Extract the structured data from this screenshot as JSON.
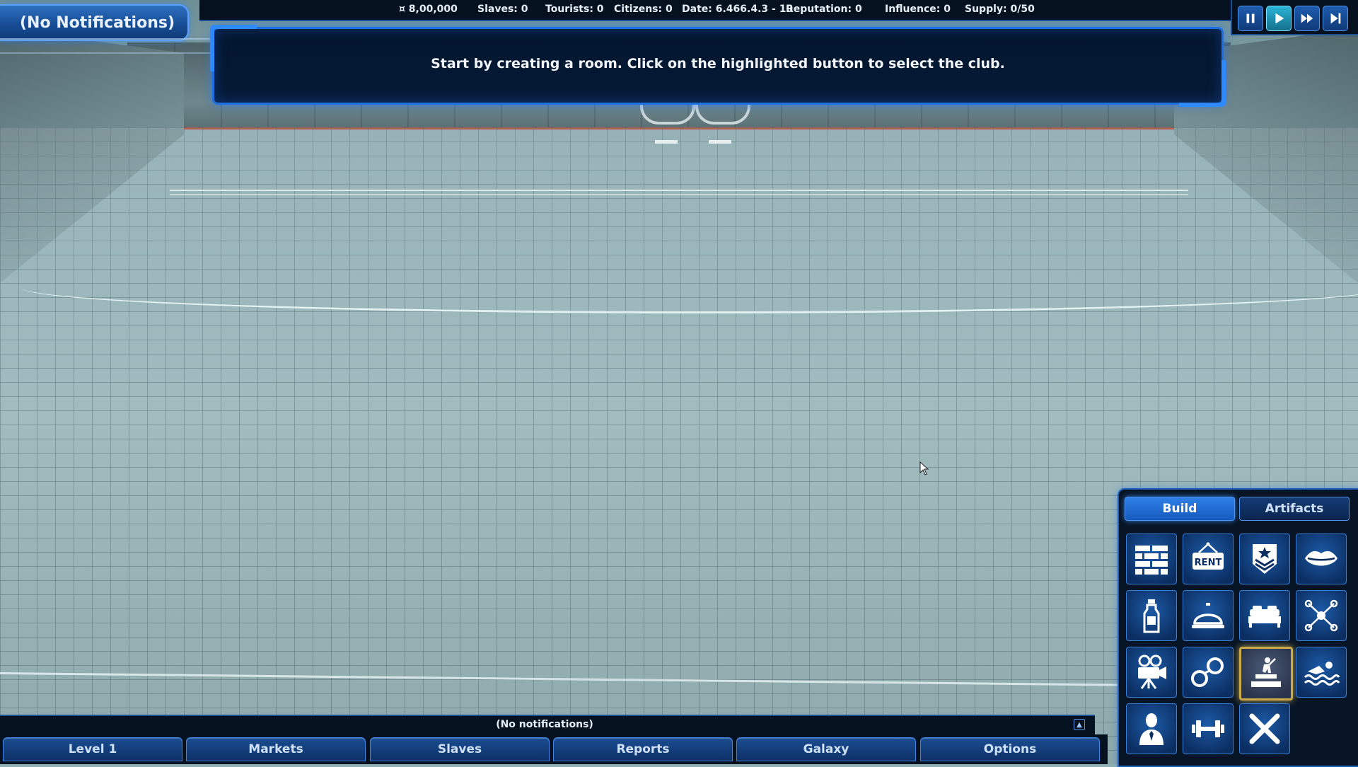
{
  "notifications": {
    "tab_label": "(No Notifications)"
  },
  "status": {
    "money": "¤ 8,00,000",
    "slaves": "Slaves: 0",
    "tourists": "Tourists: 0",
    "citizens": "Citizens: 0",
    "date": "Date: 6.466.4.3 - 10",
    "reputation": "Reputation: 0",
    "influence": "Influence: 0",
    "supply": "Supply: 0/50"
  },
  "tutorial": {
    "message": "Start by creating a room. Click on the highlighted button to select the club."
  },
  "speed_controls": {
    "active": "play",
    "buttons": [
      "pause-icon",
      "play-icon",
      "fast-forward-icon",
      "skip-icon"
    ]
  },
  "bottom_notifications": {
    "text": "(No notifications)"
  },
  "nav": {
    "level": "Level 1",
    "markets": "Markets",
    "slaves": "Slaves",
    "reports": "Reports",
    "galaxy": "Galaxy",
    "options": "Options"
  },
  "build_panel": {
    "tabs": {
      "build": "Build",
      "artifacts": "Artifacts"
    },
    "active_tab": "Build",
    "rent_label": "RENT",
    "highlighted_tile": "club-icon",
    "tiles": [
      "brick-wall-icon",
      "rent-sign-icon",
      "rank-badge-icon",
      "lips-icon",
      "bottle-icon",
      "service-bell-icon",
      "bed-icon",
      "network-icon",
      "film-camera-icon",
      "handcuffs-icon",
      "club-icon",
      "swimming-icon",
      "person-icon",
      "dumbbell-icon",
      "close-icon"
    ]
  },
  "colors": {
    "accent": "#1f6fe0",
    "highlight": "#c9a94a",
    "panel": "#071425"
  }
}
